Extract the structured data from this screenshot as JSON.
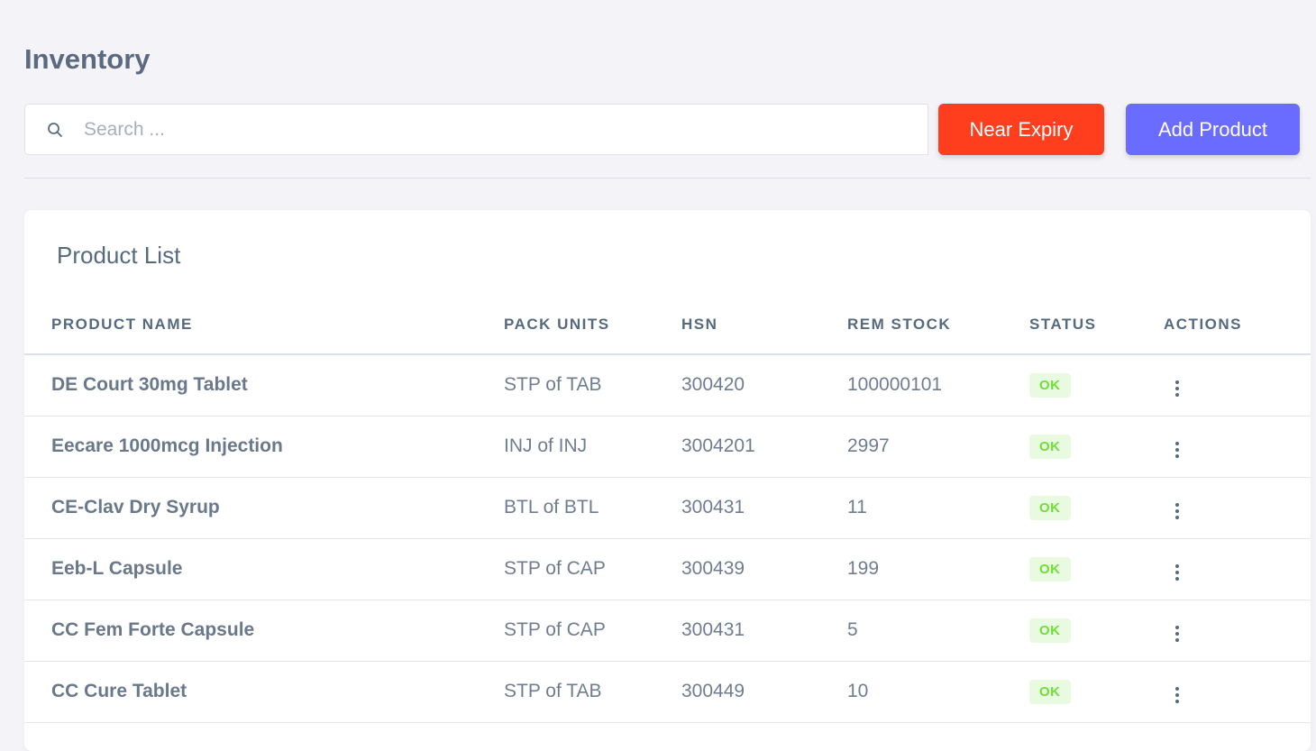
{
  "page": {
    "title": "Inventory"
  },
  "search": {
    "placeholder": "Search ...",
    "value": ""
  },
  "toolbar": {
    "near_expiry_label": "Near Expiry",
    "add_product_label": "Add Product"
  },
  "colors": {
    "near_expiry": "#ff3e1d",
    "add_product": "#696cff",
    "status_ok_bg": "#e8fadf",
    "status_ok_text": "#71dd37"
  },
  "product_list": {
    "title": "Product List",
    "columns": [
      "PRODUCT NAME",
      "PACK UNITS",
      "HSN",
      "REM STOCK",
      "STATUS",
      "ACTIONS"
    ],
    "rows": [
      {
        "name": "DE Court 30mg Tablet",
        "pack_units": "STP of TAB",
        "hsn": "300420",
        "rem_stock": "100000101",
        "status": "OK"
      },
      {
        "name": "Eecare 1000mcg Injection",
        "pack_units": "INJ of INJ",
        "hsn": "3004201",
        "rem_stock": "2997",
        "status": "OK"
      },
      {
        "name": "CE-Clav Dry Syrup",
        "pack_units": "BTL of BTL",
        "hsn": "300431",
        "rem_stock": "11",
        "status": "OK"
      },
      {
        "name": "Eeb-L Capsule",
        "pack_units": "STP of CAP",
        "hsn": "300439",
        "rem_stock": "199",
        "status": "OK"
      },
      {
        "name": "CC Fem Forte Capsule",
        "pack_units": "STP of CAP",
        "hsn": "300431",
        "rem_stock": "5",
        "status": "OK"
      },
      {
        "name": "CC Cure Tablet",
        "pack_units": "STP of TAB",
        "hsn": "300449",
        "rem_stock": "10",
        "status": "OK"
      }
    ]
  }
}
